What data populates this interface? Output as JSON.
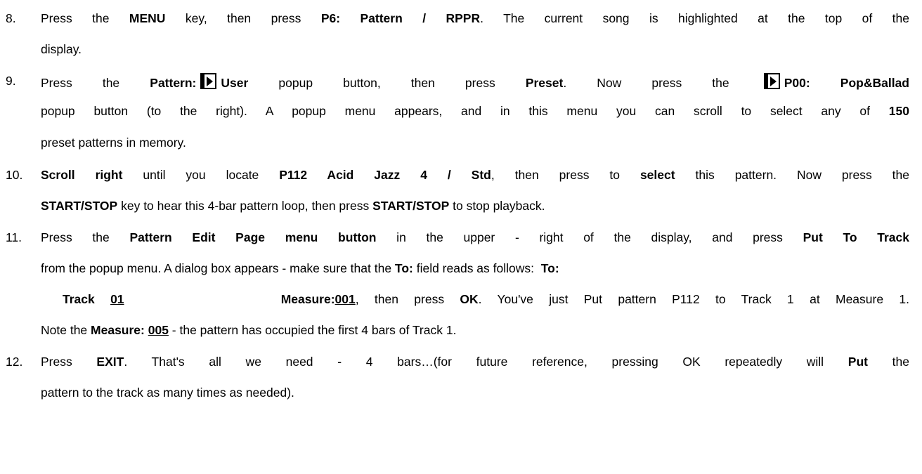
{
  "steps": [
    {
      "number": "8.",
      "lines": [
        [
          {
            "t": "Press the ",
            "b": false
          },
          {
            "t": "MENU",
            "b": true
          },
          {
            "t": " key, then press ",
            "b": false
          },
          {
            "t": "P6: Pattern / RPPR",
            "b": true
          },
          {
            "t": ". The current song is highlighted at the top of the",
            "b": false
          }
        ],
        [
          {
            "t": "display.",
            "b": false
          }
        ]
      ]
    },
    {
      "number": "9.",
      "lines": [
        [
          {
            "t": "Press the ",
            "b": false
          },
          {
            "t": "Pattern:",
            "b": true
          },
          {
            "icon": "play-popup-icon"
          },
          {
            "t": "User",
            "b": true
          },
          {
            "t": " popup button, then press ",
            "b": false
          },
          {
            "t": "Preset",
            "b": true
          },
          {
            "t": ". Now press the ",
            "b": false
          },
          {
            "icon": "play-popup-icon"
          },
          {
            "t": "P00: Pop&Ballad",
            "b": true
          }
        ],
        [
          {
            "t": "popup button (to the right). A popup menu appears, and in this menu you can scroll to select any of ",
            "b": false
          },
          {
            "t": "150",
            "b": true
          }
        ],
        [
          {
            "t": "preset patterns in memory.",
            "b": false
          }
        ]
      ]
    },
    {
      "number": "10.",
      "lines": [
        [
          {
            "t": "Scroll right",
            "b": true
          },
          {
            "t": " until you locate ",
            "b": false
          },
          {
            "t": "P112 Acid Jazz 4 / Std",
            "b": true
          },
          {
            "t": ", then press to ",
            "b": false
          },
          {
            "t": "select",
            "b": true
          },
          {
            "t": " this pattern. Now press the",
            "b": false
          }
        ],
        [
          {
            "t": "START/STOP",
            "b": true
          },
          {
            "t": " key to hear this 4-bar pattern loop, then press ",
            "b": false
          },
          {
            "t": "START/STOP",
            "b": true
          },
          {
            "t": " to stop playback.",
            "b": false
          }
        ]
      ]
    },
    {
      "number": "11.",
      "lines": [
        [
          {
            "t": "Press the ",
            "b": false
          },
          {
            "t": "Pattern Edit Page menu button",
            "b": true
          },
          {
            "t": " in the upper - right of the display, and press ",
            "b": false
          },
          {
            "t": "Put To Track",
            "b": true
          }
        ],
        [
          {
            "t": "from the popup menu. A dialog box appears - make sure that the ",
            "b": false
          },
          {
            "t": "To:",
            "b": true
          },
          {
            "t": " field reads as follows:  ",
            "b": false
          },
          {
            "t": "To:",
            "b": true
          }
        ],
        [
          {
            "t": "Track ",
            "b": true,
            "indent": true
          },
          {
            "t": "01",
            "b": true,
            "u": true
          },
          {
            "t": "          Measure:",
            "b": true
          },
          {
            "t": "001",
            "b": true,
            "u": true
          },
          {
            "t": ", then press ",
            "b": false
          },
          {
            "t": "OK",
            "b": true
          },
          {
            "t": ". You've just Put pattern P112 to Track 1 at Measure 1.",
            "b": false
          }
        ],
        [
          {
            "t": "Note the ",
            "b": false
          },
          {
            "t": "Measure: ",
            "b": true
          },
          {
            "t": "005",
            "b": true,
            "u": true
          },
          {
            "t": " - the pattern has occupied the first 4 bars of Track 1.",
            "b": false
          }
        ]
      ]
    },
    {
      "number": "12.",
      "lines": [
        [
          {
            "t": "Press ",
            "b": false
          },
          {
            "t": "EXIT",
            "b": true
          },
          {
            "t": ". That's all we need - 4 bars…(for future reference, pressing OK repeatedly will ",
            "b": false
          },
          {
            "t": "Put",
            "b": true
          },
          {
            "t": " the",
            "b": false
          }
        ],
        [
          {
            "t": "pattern to the track as many times as needed).",
            "b": false
          }
        ]
      ]
    }
  ]
}
